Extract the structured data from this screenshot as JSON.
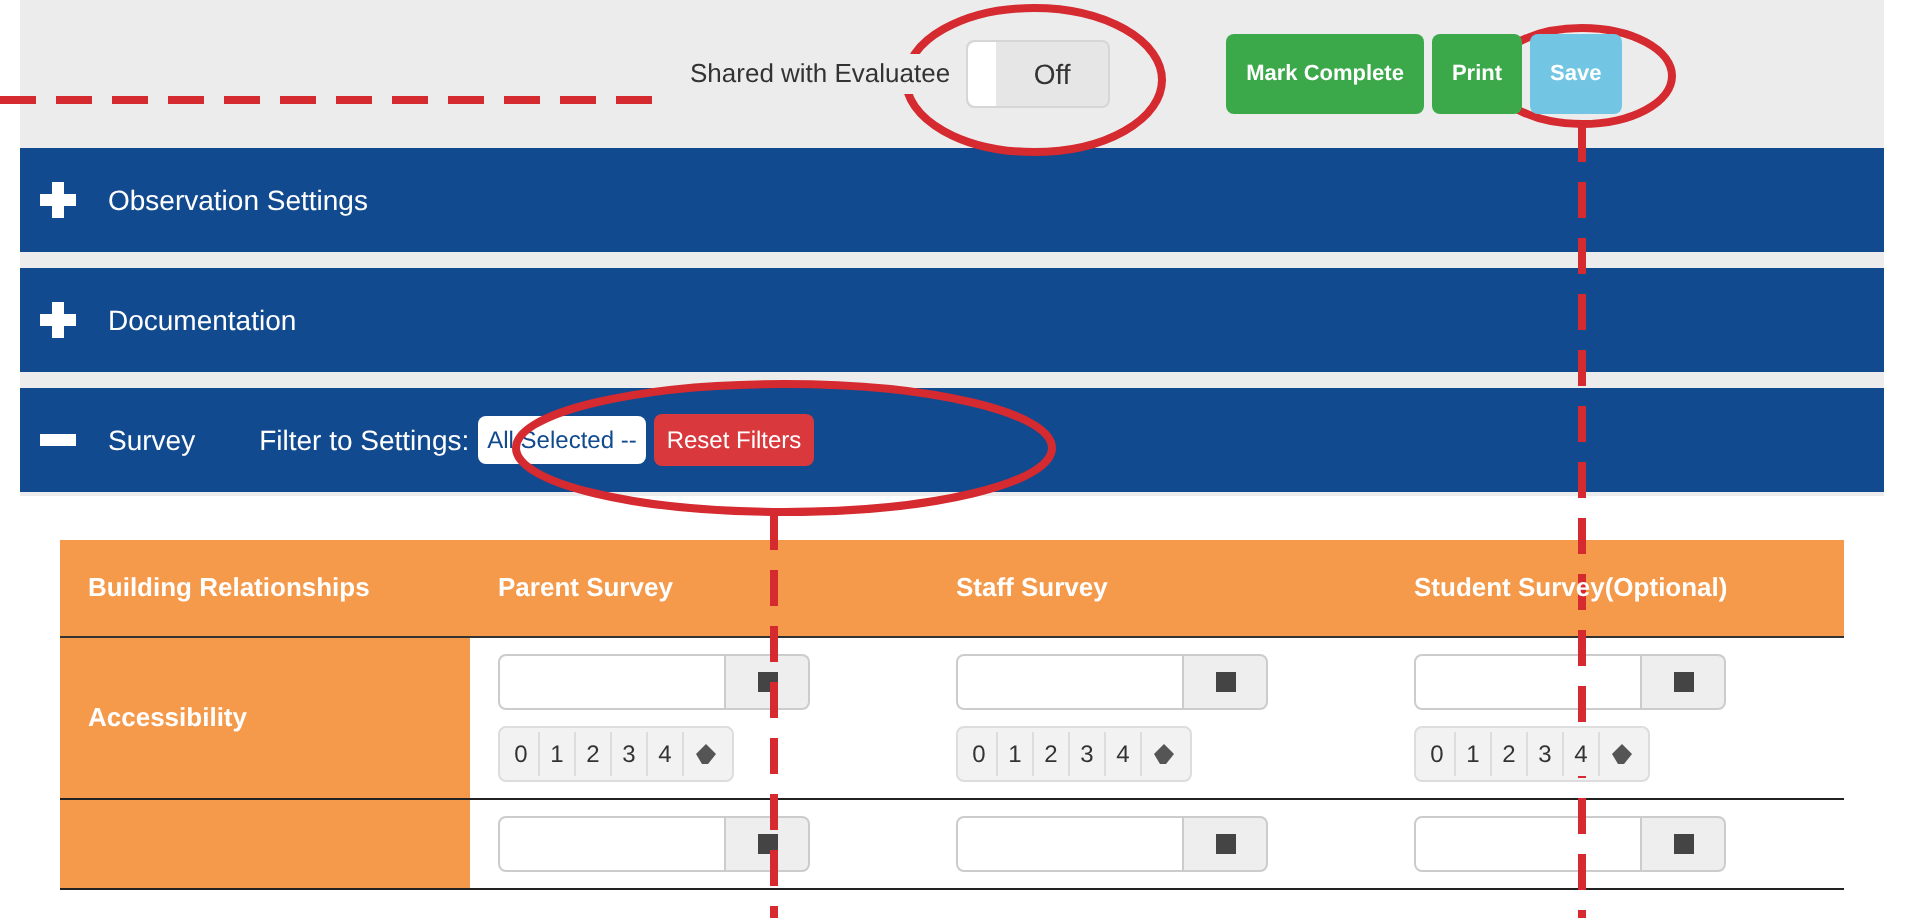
{
  "toolbar": {
    "shared_label": "Shared with Evaluatee",
    "toggle": {
      "on": false,
      "label": "Off"
    },
    "buttons": [
      {
        "label": "Mark Complete",
        "kind": "success"
      },
      {
        "label": "Print",
        "kind": "success"
      },
      {
        "label": "Save",
        "kind": "info"
      }
    ]
  },
  "sections": [
    {
      "title": "Observation Settings",
      "expanded": false
    },
    {
      "title": "Documentation",
      "expanded": false
    },
    {
      "title": "Survey",
      "expanded": true,
      "filter_label": "Filter to Settings:",
      "filter_select": "All Selected --",
      "reset_button": "Reset Filters"
    }
  ],
  "table": {
    "corner": "Building Relationships",
    "columns": [
      "Parent Survey",
      "Staff Survey",
      "Student Survey(Optional)"
    ],
    "rows": [
      {
        "label": "Accessibility",
        "cells": [
          {
            "scores": [
              "0",
              "1",
              "2",
              "3",
              "4"
            ]
          },
          {
            "scores": [
              "0",
              "1",
              "2",
              "3",
              "4"
            ]
          },
          {
            "scores": [
              "0",
              "1",
              "2",
              "3",
              "4"
            ]
          }
        ]
      },
      {
        "cells": [
          {},
          {},
          {}
        ]
      }
    ]
  }
}
